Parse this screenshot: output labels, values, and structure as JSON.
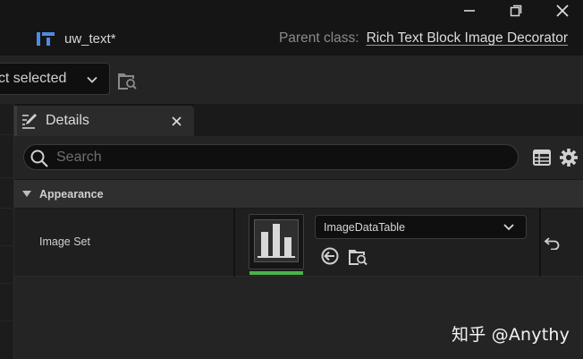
{
  "window": {
    "controls": {
      "minimize_icon": "minimize-icon",
      "maximize_icon": "restore-icon",
      "close_icon": "close-icon"
    }
  },
  "asset_tab": {
    "title": "uw_text*",
    "icon": "widget-blueprint-icon"
  },
  "parent_class": {
    "label": "Parent class:",
    "value": "Rich Text Block Image Decorator"
  },
  "toolbar": {
    "selection_label": "ect selected",
    "browse_icon": "folder-search-icon"
  },
  "details": {
    "tab_title": "Details",
    "search": {
      "placeholder": "Search",
      "value": ""
    },
    "section": {
      "title": "Appearance",
      "expanded": true
    },
    "properties": [
      {
        "name": "Image Set",
        "asset_value": "ImageDataTable",
        "thumbnail_icon": "data-table-icon"
      }
    ]
  },
  "watermark": "知乎 @Anythy",
  "colors": {
    "background": "#151515",
    "panel": "#242424",
    "section": "#2f2f2f",
    "accent_green": "#4bb34b",
    "text": "#cfcfcf"
  }
}
